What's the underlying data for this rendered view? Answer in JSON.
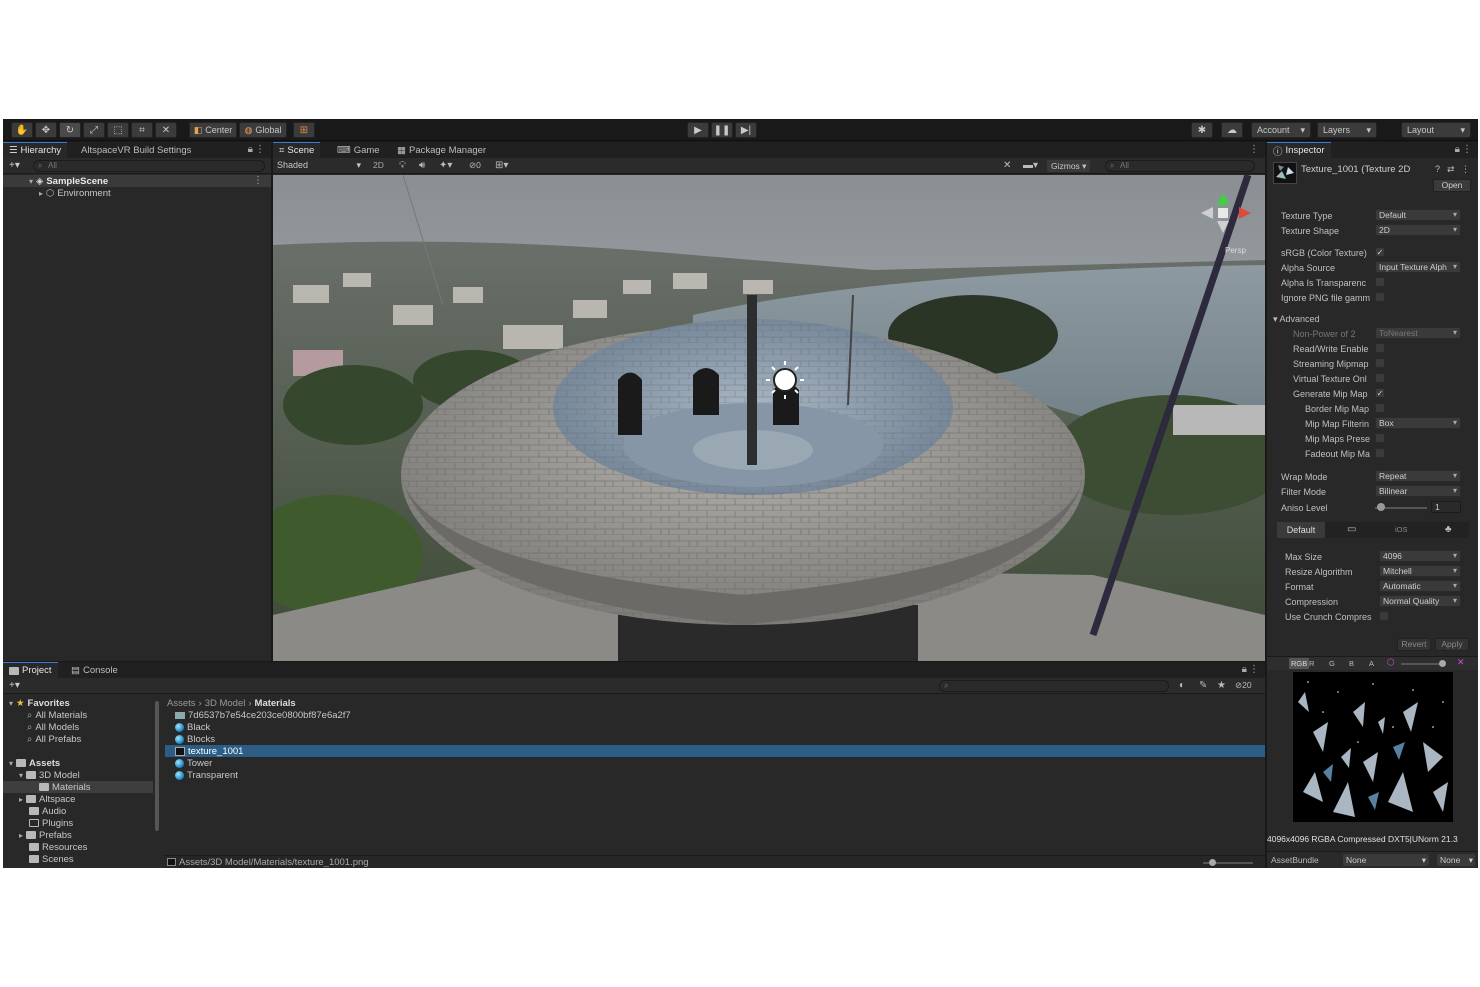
{
  "toolbar": {
    "pivot_label": "Center",
    "space_label": "Global",
    "account_label": "Account",
    "layers_label": "Layers",
    "layout_label": "Layout"
  },
  "hierarchy": {
    "tab_label": "Hierarchy",
    "tab2_label": "AltspaceVR Build Settings",
    "search_placeholder": "All",
    "scene_name": "SampleScene",
    "child_name": "Environment"
  },
  "scene_view": {
    "tabs": [
      "Scene",
      "Game",
      "Package Manager"
    ],
    "shading_mode": "Shaded",
    "mode_2d": "2D",
    "hidden_count": "0",
    "gizmos_label": "Gizmos",
    "search_placeholder": "All",
    "persp_label": "Persp"
  },
  "inspector": {
    "tab_label": "Inspector",
    "asset_title": "Texture_1001 (Texture 2D",
    "open_button": "Open",
    "fields": {
      "texture_type": {
        "label": "Texture Type",
        "value": "Default"
      },
      "texture_shape": {
        "label": "Texture Shape",
        "value": "2D"
      },
      "srgb": {
        "label": "sRGB (Color Texture)",
        "checked": true
      },
      "alpha_source": {
        "label": "Alpha Source",
        "value": "Input Texture Alph"
      },
      "alpha_is_transparency": {
        "label": "Alpha Is Transparenc",
        "checked": false
      },
      "ignore_png_gamma": {
        "label": "Ignore PNG file gamm",
        "checked": false
      },
      "advanced": {
        "label": "Advanced"
      },
      "non_power_of_2": {
        "label": "Non-Power of 2",
        "value": "ToNearest"
      },
      "read_write": {
        "label": "Read/Write Enable",
        "checked": false
      },
      "streaming_mipmaps": {
        "label": "Streaming Mipmap",
        "checked": false
      },
      "virtual_texture": {
        "label": "Virtual Texture Onl",
        "checked": false
      },
      "generate_mip": {
        "label": "Generate Mip Map",
        "checked": true
      },
      "border_mip": {
        "label": "Border Mip Map",
        "checked": false
      },
      "mip_filtering": {
        "label": "Mip Map Filterin",
        "value": "Box"
      },
      "mip_preserve": {
        "label": "Mip Maps Prese",
        "checked": false
      },
      "fadeout_mip": {
        "label": "Fadeout Mip Ma",
        "checked": false
      },
      "wrap_mode": {
        "label": "Wrap Mode",
        "value": "Repeat"
      },
      "filter_mode": {
        "label": "Filter Mode",
        "value": "Bilinear"
      },
      "aniso_level": {
        "label": "Aniso Level",
        "value": "1",
        "fraction": 0.05
      }
    },
    "platform": {
      "default_tab": "Default",
      "ios_tab": "iOS",
      "max_size": {
        "label": "Max Size",
        "value": "4096"
      },
      "resize": {
        "label": "Resize Algorithm",
        "value": "Mitchell"
      },
      "format": {
        "label": "Format",
        "value": "Automatic"
      },
      "compression": {
        "label": "Compression",
        "value": "Normal Quality"
      },
      "crunch": {
        "label": "Use Crunch Compres",
        "checked": false
      }
    },
    "revert_button": "Revert",
    "apply_button": "Apply",
    "preview": {
      "channels": [
        "RGB",
        "R",
        "G",
        "B",
        "A"
      ],
      "info": "4096x4096 RGBA Compressed DXT5|UNorm  21.3"
    },
    "assetbundle_label": "AssetBundle",
    "assetbundle_value": "None",
    "assetbundle_variant": "None"
  },
  "project": {
    "tabs": [
      "Project",
      "Console"
    ],
    "favorites_header": "Favorites",
    "favorites": [
      "All Materials",
      "All Models",
      "All Prefabs"
    ],
    "assets_header": "Assets",
    "tree": [
      {
        "label": "3D Model",
        "depth": 1
      },
      {
        "label": "Materials",
        "depth": 2,
        "selected": true
      },
      {
        "label": "Altspace",
        "depth": 1
      },
      {
        "label": "Audio",
        "depth": 1
      },
      {
        "label": "Plugins",
        "depth": 1
      },
      {
        "label": "Prefabs",
        "depth": 1
      },
      {
        "label": "Resources",
        "depth": 1
      },
      {
        "label": "Scenes",
        "depth": 1
      }
    ],
    "breadcrumb": [
      "Assets",
      "3D Model",
      "Materials"
    ],
    "files": [
      {
        "name": "7d6537b7e54ce203ce0800bf87e6a2f7",
        "kind": "texture"
      },
      {
        "name": "Black",
        "kind": "material"
      },
      {
        "name": "Blocks",
        "kind": "material"
      },
      {
        "name": "texture_1001",
        "kind": "texture",
        "selected": true
      },
      {
        "name": "Tower",
        "kind": "material"
      },
      {
        "name": "Transparent",
        "kind": "material"
      }
    ],
    "hidden_count": "20",
    "status_path": "Assets/3D Model/Materials/texture_1001.png"
  },
  "colors": {
    "selection": "#2c5d87",
    "accent": "#3a7bd5"
  }
}
